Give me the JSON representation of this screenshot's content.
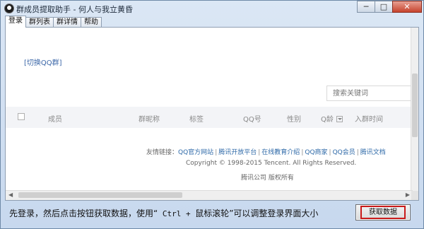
{
  "window": {
    "title": "群成员提取助手 - 何人与我立黄昏",
    "controls": {
      "minimize": "─",
      "maximize": "□",
      "close": "✕"
    }
  },
  "tabs": [
    {
      "label": "登录",
      "active": true
    },
    {
      "label": "群列表",
      "active": false
    },
    {
      "label": "群详情",
      "active": false
    },
    {
      "label": "帮助",
      "active": false
    }
  ],
  "content": {
    "switch_link": "[切换QQ群]",
    "search_placeholder": "搜索关键词",
    "table_headers": {
      "member": "成员",
      "group_nick": "群昵称",
      "tag": "标签",
      "qq": "QQ号",
      "gender": "性别",
      "q_age": "Q龄",
      "join_time": "入群时间"
    },
    "footer": {
      "links_label": "友情链接：",
      "links": [
        "QQ官方网站",
        "腾讯开放平台",
        "在线教育介绍",
        "QQ商家",
        "QQ会员",
        "腾讯文档"
      ],
      "copyright": "Copyright © 1998-2015 Tencent. All Rights Reserved.",
      "company": "腾讯公司 版权所有"
    }
  },
  "bottom": {
    "hint_before": "先登录，然后点击按钮获取数据，使用“",
    "hint_keys": " Ctrl + ",
    "hint_mid": "鼠标滚轮",
    "hint_after": "”可以调整登录界面大小",
    "fetch_button": "获取数据"
  },
  "colors": {
    "link": "#2f6aa8",
    "highlight_outline": "#c91a1a",
    "close_button": "#c6432d"
  }
}
